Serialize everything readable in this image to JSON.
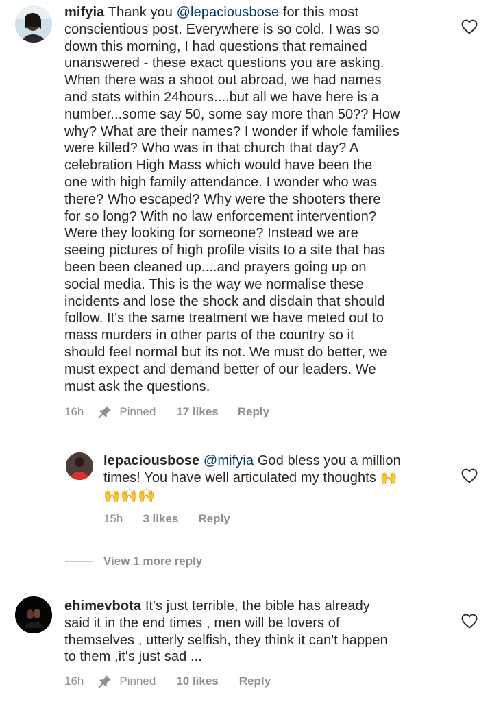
{
  "comments": [
    {
      "username": "mifyia",
      "mention": "@lepaciousbose",
      "text_lines": [
        " for this most",
        "conscientious post. Everywhere is so cold. I was so",
        "down  this morning, I had questions that remained",
        "unanswered - these exact questions you are asking.",
        "When there was a shoot out abroad, we had names",
        "and stats within 24hours....but all we have here is a",
        "number...some say 50, some say more than 50?? How",
        "why? What are their names? I wonder if whole families",
        "were killed? Who was in that church that day? A",
        "celebration High Mass which would have been the",
        "one with high family attendance. I wonder who was",
        "there? Who escaped?  Why were the shooters there",
        "for so long? With no law enforcement intervention?",
        "Were they looking for someone? Instead we are",
        "seeing pictures of  high profile visits to a site that has",
        "been been cleaned up....and prayers going up on",
        "social media. This is the way we normalise these",
        "incidents and lose the shock and disdain that should",
        "follow. It's the same treatment we have meted out to",
        "mass murders in other  parts of the country so it",
        "should feel normal but its not. We must do better, we",
        "must expect and demand better of our leaders. We",
        "must ask the questions."
      ],
      "first_prefix": "Thank you ",
      "time": "16h",
      "pinned": "Pinned",
      "likes": "17 likes",
      "reply": "Reply"
    },
    {
      "username": "lepaciousbose",
      "mention": "@mifyia",
      "line1_rest": " God bless you a million",
      "line2": "times! You have well articulated my thoughts 🙌",
      "line3": "🙌🙌🙌",
      "time": "15h",
      "likes": "3 likes",
      "reply": "Reply"
    },
    {
      "username": "ehimevbota",
      "line1_rest": " It's just terrible,  the bible has already",
      "line2": "said it in the end times , men will be lovers of",
      "line3": "themselves , utterly selfish, they think it can't happen",
      "line4": "to them ,it's just sad ...",
      "time": "16h",
      "pinned": "Pinned",
      "likes": "10 likes",
      "reply": "Reply"
    }
  ],
  "view_more": "View 1 more reply",
  "icons": {
    "heart": "heart-outline-icon",
    "pin": "pin-icon"
  },
  "colors": {
    "mention": "#00376b",
    "meta": "#8e8e8e"
  }
}
